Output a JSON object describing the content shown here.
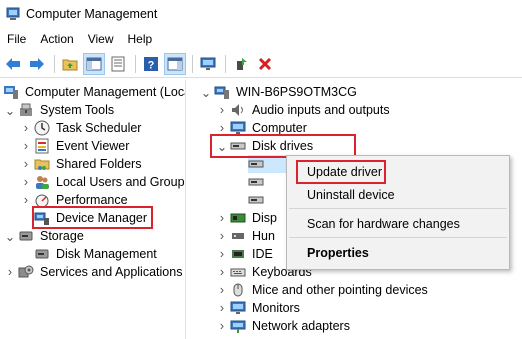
{
  "window": {
    "title": "Computer Management"
  },
  "menu": [
    "File",
    "Action",
    "View",
    "Help"
  ],
  "left_tree": {
    "root": "Computer Management (Local",
    "system_tools": "System Tools",
    "task_scheduler": "Task Scheduler",
    "event_viewer": "Event Viewer",
    "shared_folders": "Shared Folders",
    "local_users": "Local Users and Groups",
    "performance": "Performance",
    "device_manager": "Device Manager",
    "storage": "Storage",
    "disk_management": "Disk Management",
    "services": "Services and Applications"
  },
  "right_tree": {
    "computer_name": "WIN-B6PS9OTM3CG",
    "audio": "Audio inputs and outputs",
    "computer": "Computer",
    "disk_drives": "Disk drives",
    "display_partial": "Disp",
    "hid_partial": "Hun",
    "ide_partial": "IDE",
    "keyboards": "Keyboards",
    "mice": "Mice and other pointing devices",
    "monitors": "Monitors",
    "network": "Network adapters"
  },
  "context_menu": {
    "update_driver": "Update driver",
    "uninstall": "Uninstall device",
    "scan": "Scan for hardware changes",
    "properties": "Properties"
  },
  "colors": {
    "highlight": "#d9232e",
    "selection": "#cce8ff",
    "accent": "#1a73c8"
  }
}
